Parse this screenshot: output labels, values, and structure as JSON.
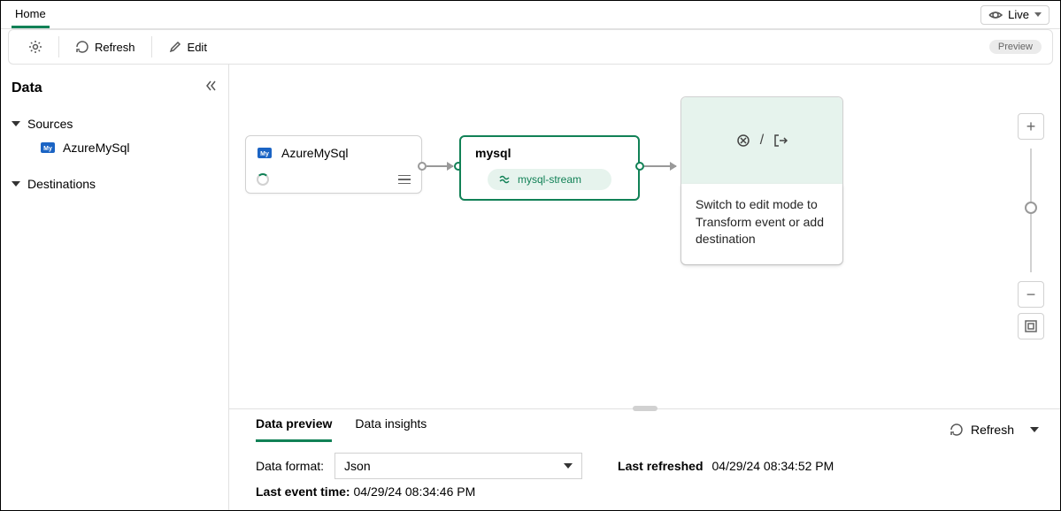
{
  "nav": {
    "home": "Home",
    "live": "Live"
  },
  "toolbar": {
    "refresh": "Refresh",
    "edit": "Edit",
    "preview": "Preview"
  },
  "sidebar": {
    "title": "Data",
    "sources_label": "Sources",
    "destinations_label": "Destinations",
    "source_items": [
      "AzureMySql"
    ]
  },
  "canvas": {
    "source_node": {
      "title": "AzureMySql"
    },
    "stream_node": {
      "title": "mysql",
      "pill": "mysql-stream"
    },
    "dest_node": {
      "hint": "Switch to edit mode to Transform event or add destination"
    }
  },
  "bottom": {
    "tabs": {
      "preview": "Data preview",
      "insights": "Data insights"
    },
    "refresh": "Refresh",
    "format_label": "Data format:",
    "format_value": "Json",
    "last_refreshed_label": "Last refreshed",
    "last_refreshed_value": "04/29/24 08:34:52 PM",
    "last_event_label": "Last event time:",
    "last_event_value": "04/29/24 08:34:46 PM"
  }
}
